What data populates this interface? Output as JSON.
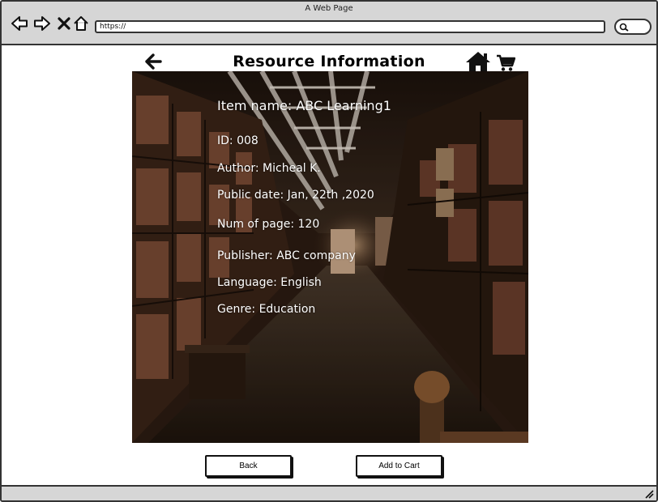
{
  "browser": {
    "window_title": "A Web Page",
    "url": "https://",
    "icons": [
      "back-icon",
      "forward-icon",
      "close-icon",
      "home-icon",
      "search-icon"
    ]
  },
  "page": {
    "title": "Resource Information",
    "icons": [
      "back-arrow-icon",
      "home-icon",
      "cart-icon"
    ]
  },
  "resource": {
    "item_name": "Item name: ABC Learning1",
    "id": "ID: 008",
    "author": "Author: Micheal K.",
    "public_date": "Public date: Jan, 22th ,2020",
    "num_pages": "Num of page: 120",
    "publisher": "Publisher: ABC company",
    "language": "Language: English",
    "genre": "Genre: Education"
  },
  "actions": {
    "back_label": "Back",
    "add_to_cart_label": "Add to Cart"
  },
  "colors": {
    "chrome_bg": "#d6d6d6",
    "border": "#333333",
    "info_text": "#ffffff"
  }
}
